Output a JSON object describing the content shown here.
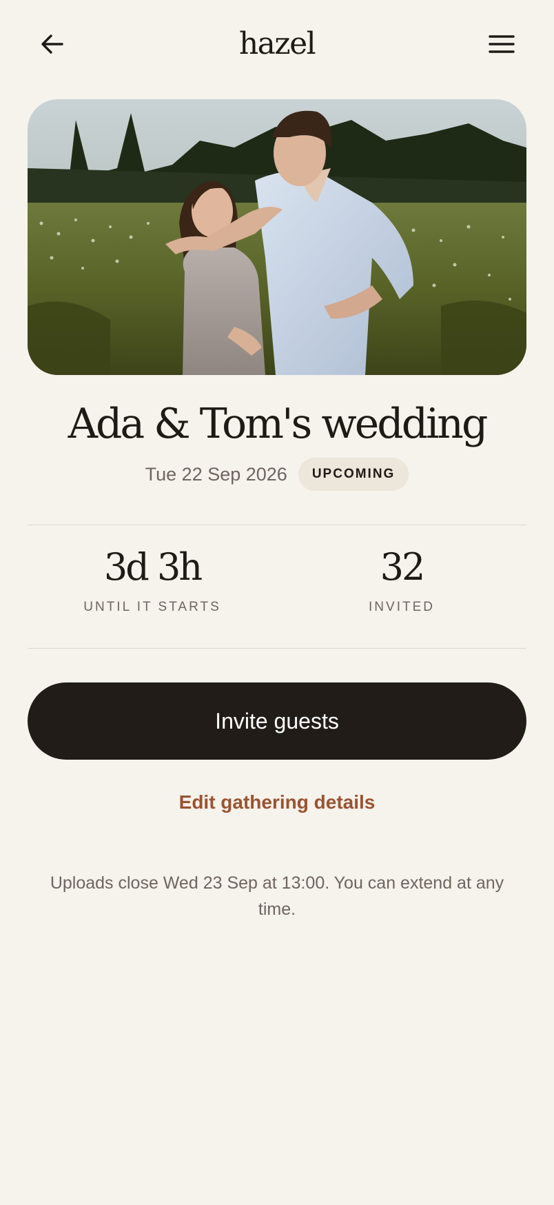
{
  "header": {
    "logo": "hazel",
    "back_icon": "arrow-left-icon",
    "menu_icon": "hamburger-menu-icon"
  },
  "hero": {
    "image": "couple-in-meadow-photo"
  },
  "event": {
    "title": "Ada & Tom's wedding",
    "date": "Tue 22 Sep 2026",
    "status": "UPCOMING"
  },
  "stats": [
    {
      "value": "3d 3h",
      "label": "UNTIL IT STARTS"
    },
    {
      "value": "32",
      "label": "INVITED"
    }
  ],
  "actions": {
    "primary_label": "Invite guests",
    "secondary_label": "Edit gathering details"
  },
  "note": "Uploads close Wed 23 Sep at 13:00. You can extend at any time.",
  "colors": {
    "background": "#f6f2ec",
    "primary_button": "#211c17",
    "accent_link": "#9a5330",
    "badge_bg": "#ede6da",
    "muted_text": "#6e665d"
  }
}
